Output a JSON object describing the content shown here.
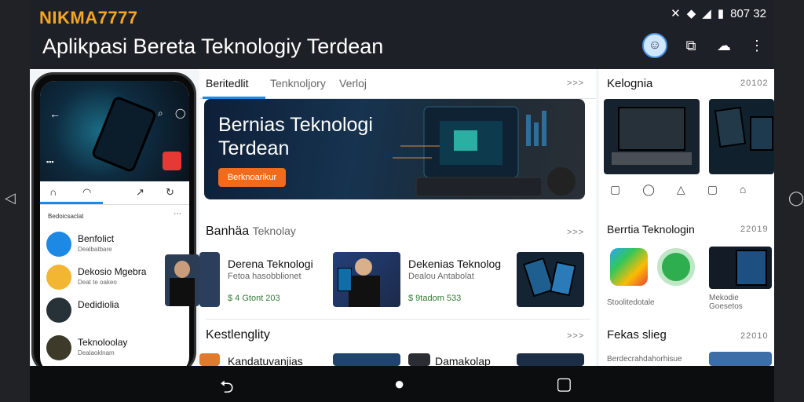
{
  "status": {
    "brand": "NIKMA7777",
    "time": "807 32"
  },
  "appbar": {
    "title": "Aplikpasi Bereta Teknologiy Terdean",
    "actions": [
      "avatar",
      "layers-icon",
      "cloud-icon",
      "more-vert-icon"
    ]
  },
  "tabs": [
    {
      "label": "Beritedlit",
      "active": true
    },
    {
      "label": "Tenknoljory",
      "active": false
    },
    {
      "label": "Verloj",
      "active": false
    }
  ],
  "more": ">>>",
  "hero": {
    "title": "Bernias Teknologi Terdean",
    "button": "Berknoarikur"
  },
  "section1": {
    "title": "Banhäa",
    "title_light": "Teknolay",
    "cards": [
      {
        "title": "Derena Teknologi",
        "sub": "Fetoa hasobblionet",
        "price": "$ 4 Gtont 203"
      },
      {
        "title": "Dekenias Teknolog",
        "sub": "Dealou Antabolat",
        "price": "$ 9tadom 533"
      }
    ]
  },
  "section2": {
    "title": "Kestlenglity",
    "cards": [
      {
        "title": "Kandatuvanjias"
      },
      {
        "title": "Damakolap"
      }
    ]
  },
  "right_panel": {
    "sections": [
      {
        "title": "Kelognia",
        "count": "20102"
      },
      {
        "title": "Berrtia Teknologin",
        "count": "22019"
      },
      {
        "title": "Fekas slieg",
        "count": "22010"
      }
    ],
    "tiles": [
      {
        "label": "Stoolitedotale"
      },
      {
        "label": "Mekodie Goesetos"
      }
    ],
    "footer_note": "Berdecrahdahorhisue"
  },
  "phone": {
    "list_head": "Bedoicsaclat",
    "items": [
      {
        "label": "Benfolict",
        "sub": "Dealbatbare"
      },
      {
        "label": "Dekosio Mgebra",
        "sub": "Deat te oakeo"
      },
      {
        "label": "Dedidiolia",
        "sub": ""
      },
      {
        "label": "Teknoloolay",
        "sub": "Dealaoklnam"
      }
    ]
  },
  "colors": {
    "accent": "#f5a623",
    "hero_button": "#f26b1d",
    "tab_underline": "#1e88e5",
    "price": "#2e7d32"
  }
}
